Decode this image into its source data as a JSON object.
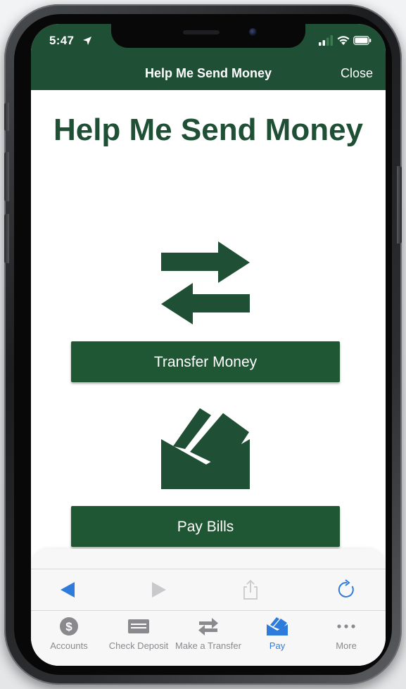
{
  "status_bar": {
    "time": "5:47",
    "location_icon": "location-arrow-icon",
    "signal_icon": "cellular-signal-icon",
    "wifi_icon": "wifi-icon",
    "battery_icon": "battery-icon"
  },
  "nav": {
    "title": "Help Me Send Money",
    "close_label": "Close"
  },
  "main": {
    "heading": "Help Me Send Money",
    "transfer_icon": "transfer-arrows-icon",
    "transfer_button_label": "Transfer Money",
    "bills_icon": "envelope-cards-icon",
    "bills_button_label": "Pay Bills"
  },
  "browser_controls": {
    "back_icon": "back-arrow-icon",
    "forward_icon": "forward-arrow-icon",
    "share_icon": "share-icon",
    "reload_icon": "reload-icon"
  },
  "tab_bar": {
    "items": [
      {
        "label": "Accounts",
        "icon": "dollar-icon",
        "active": false
      },
      {
        "label": "Check Deposit",
        "icon": "check-icon",
        "active": false
      },
      {
        "label": "Make a Transfer",
        "icon": "transfer-icon",
        "active": false
      },
      {
        "label": "Pay",
        "icon": "pay-icon",
        "active": true
      },
      {
        "label": "More",
        "icon": "more-icon",
        "active": false
      }
    ]
  },
  "colors": {
    "brand_green": "#1f4f34",
    "button_green": "#1f5633",
    "active_tab_blue": "#2f7bdc",
    "inactive_tab_gray": "#8a8a8e"
  }
}
